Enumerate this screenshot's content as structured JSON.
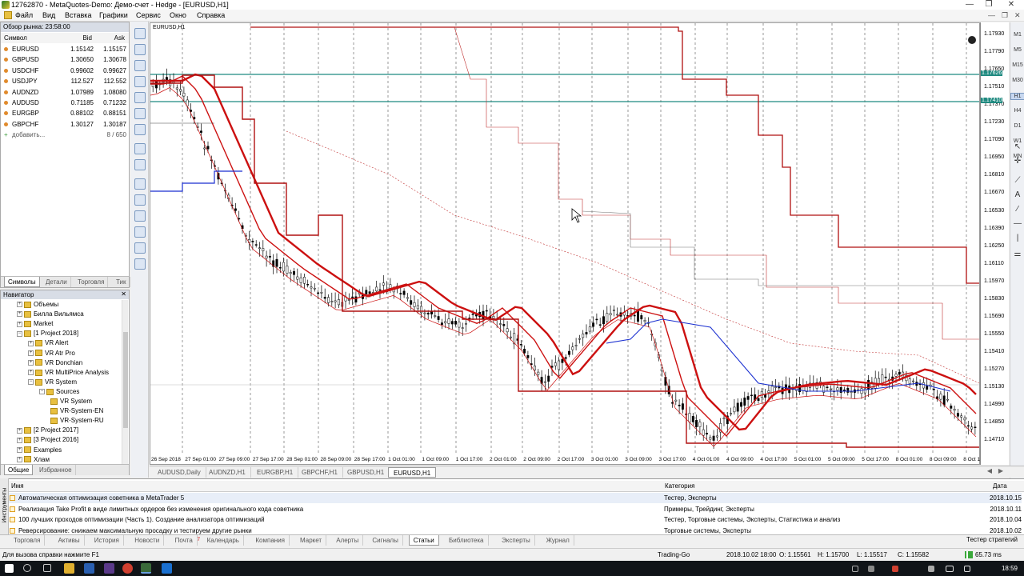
{
  "window": {
    "title": "12762870 - MetaQuotes-Demo: Демо-счет - Hedge - [EURUSD,H1]"
  },
  "menu": [
    "Файл",
    "Вид",
    "Вставка",
    "Графики",
    "Сервис",
    "Окно",
    "Справка"
  ],
  "market_watch": {
    "header": "Обзор рынка: 23:58:00",
    "col_symbol": "Символ",
    "col_bid": "Bid",
    "col_ask": "Ask",
    "rows": [
      {
        "symbol": "EURUSD",
        "bid": "1.15142",
        "ask": "1.15157"
      },
      {
        "symbol": "GBPUSD",
        "bid": "1.30650",
        "ask": "1.30678"
      },
      {
        "symbol": "USDCHF",
        "bid": "0.99602",
        "ask": "0.99627"
      },
      {
        "symbol": "USDJPY",
        "bid": "112.527",
        "ask": "112.552"
      },
      {
        "symbol": "AUDNZD",
        "bid": "1.07989",
        "ask": "1.08080"
      },
      {
        "symbol": "AUDUSD",
        "bid": "0.71185",
        "ask": "0.71232"
      },
      {
        "symbol": "EURGBP",
        "bid": "0.88102",
        "ask": "0.88151"
      },
      {
        "symbol": "GBPCHF",
        "bid": "1.30127",
        "ask": "1.30187"
      }
    ],
    "add_label": "добавить...",
    "count": "8 / 650",
    "tabs": [
      "Символы",
      "Детали",
      "Торговля",
      "Тик"
    ]
  },
  "navigator": {
    "header": "Навигатор",
    "items": [
      {
        "label": "Объемы",
        "level": 1
      },
      {
        "label": "Билла Вильямса",
        "level": 1
      },
      {
        "label": "Market",
        "level": 1
      },
      {
        "label": "[1 Project 2018]",
        "level": 1
      },
      {
        "label": "VR Alert",
        "level": 2
      },
      {
        "label": "VR Atr Pro",
        "level": 2
      },
      {
        "label": "VR Donchian",
        "level": 2
      },
      {
        "label": "VR MultiPrice Analysis",
        "level": 2
      },
      {
        "label": "VR System",
        "level": 2
      },
      {
        "label": "Sources",
        "level": 3
      },
      {
        "label": "VR System",
        "level": 4
      },
      {
        "label": "VR-System-EN",
        "level": 4
      },
      {
        "label": "VR-System-RU",
        "level": 4
      },
      {
        "label": "[2 Project 2017]",
        "level": 1
      },
      {
        "label": "[3 Project 2016]",
        "level": 1
      },
      {
        "label": "Examples",
        "level": 1
      },
      {
        "label": "Хлам",
        "level": 1
      }
    ],
    "tabs": [
      "Общие",
      "Избранное"
    ]
  },
  "chart": {
    "label": "EURUSD,H1",
    "price_labels": [
      "1.17930",
      "1.17790",
      "1.17650",
      "1.17510",
      "1.17370",
      "1.17230",
      "1.17090",
      "1.16950",
      "1.16810",
      "1.16670",
      "1.16530",
      "1.16390",
      "1.16250",
      "1.16110",
      "1.15970",
      "1.15830",
      "1.15690",
      "1.15550",
      "1.15410",
      "1.15270",
      "1.15130",
      "1.14990",
      "1.14850",
      "1.14710"
    ],
    "hline_labels": [
      "1.17626",
      "1.17410"
    ],
    "time_labels": [
      "26 Sep 2018",
      "27 Sep 01:00",
      "27 Sep 09:00",
      "27 Sep 17:00",
      "28 Sep 01:00",
      "28 Sep 09:00",
      "28 Sep 17:00",
      "1 Oct 01:00",
      "1 Oct 09:00",
      "1 Oct 17:00",
      "2 Oct 01:00",
      "2 Oct 09:00",
      "2 Oct 17:00",
      "3 Oct 01:00",
      "3 Oct 09:00",
      "3 Oct 17:00",
      "4 Oct 01:00",
      "4 Oct 09:00",
      "4 Oct 17:00",
      "5 Oct 01:00",
      "5 Oct 09:00",
      "5 Oct 17:00",
      "8 Oct 01:00",
      "8 Oct 09:00",
      "8 Oct 17:00"
    ],
    "colors": {
      "bull": "#ffffff",
      "bear": "#000000",
      "ma": "#cc1010",
      "channel": "#b01010",
      "blue": "#1a2fd0",
      "hline": "#1f8a80"
    }
  },
  "timeframes": [
    "M1",
    "M5",
    "M15",
    "M30",
    "H1",
    "H4",
    "D1",
    "W1",
    "MN"
  ],
  "chart_tabs": [
    "AUDUSD,Daily",
    "AUDNZD,H1",
    "EURGBP,H1",
    "GBPCHF,H1",
    "GBPUSD,H1",
    "EURUSD,H1"
  ],
  "toolbox": {
    "side_label": "Инструменты",
    "col_name": "Имя",
    "col_category": "Категория",
    "col_date": "Дата",
    "rows": [
      {
        "name": "Автоматическая оптимизация советника в MetaTrader 5",
        "category": "Тестер, Эксперты",
        "date": "2018.10.15"
      },
      {
        "name": "Реализация Take Profit в виде лимитных ордеров без изменения оригинального кода советника",
        "category": "Примеры, Трейдинг, Эксперты",
        "date": "2018.10.11"
      },
      {
        "name": "100 лучших проходов оптимизации (Часть 1). Создание анализатора оптимизаций",
        "category": "Тестер, Торговые системы, Эксперты, Статистика и анализ",
        "date": "2018.10.04"
      },
      {
        "name": "Реверсирование: снижаем максимальную просадку и тестируем другие рынки",
        "category": "Торговые системы, Эксперты",
        "date": "2018.10.02"
      }
    ],
    "tabs": [
      "Торговля",
      "Активы",
      "История",
      "Новости",
      "Почта",
      "Календарь",
      "Компания",
      "Маркет",
      "Алерты",
      "Сигналы",
      "Статьи",
      "Библиотека",
      "Эксперты",
      "Журнал"
    ],
    "mail_badge": "7",
    "right_tab": "Тестер стратегий"
  },
  "status": {
    "help": "Для вызова справки нажмите F1",
    "profile": "Trading-Go",
    "datetime": "2018.10.02 18:00",
    "open": "O: 1.15561",
    "high": "H: 1.15700",
    "low": "L: 1.15517",
    "close": "C: 1.15582",
    "traffic": "65.73 ms"
  },
  "taskbar": {
    "clock": "18:59"
  }
}
